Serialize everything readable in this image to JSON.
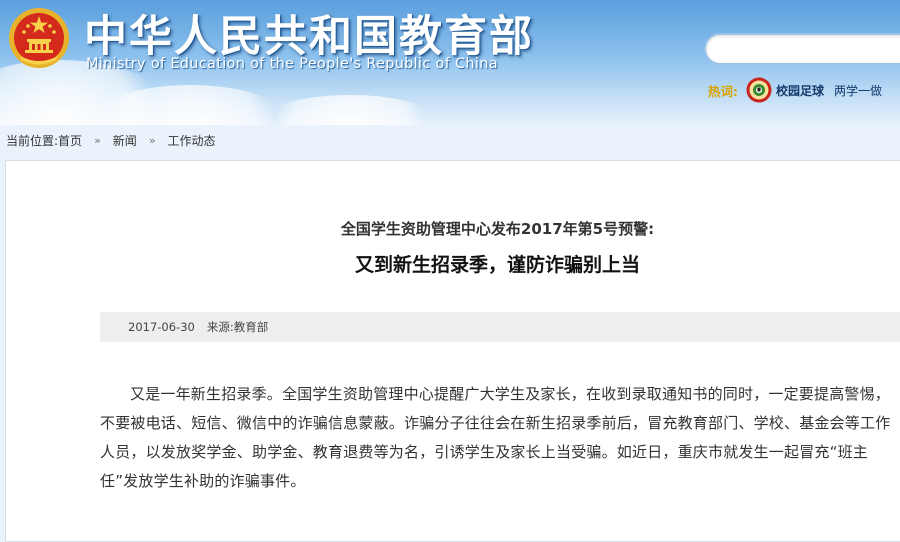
{
  "header": {
    "title": "中华人民共和国教育部",
    "subtitle": "Ministry of Education of the People's Republic of China",
    "search": {
      "value": "",
      "placeholder": ""
    },
    "hot": {
      "label": "热词:",
      "links": [
        "校园足球",
        "两学一做"
      ],
      "link_icons": [
        "football-icon"
      ]
    }
  },
  "breadcrumb": {
    "prefix": "当前位置:",
    "items": [
      "首页",
      "新闻",
      "工作动态"
    ],
    "separator": "»"
  },
  "article": {
    "subtitle": "全国学生资助管理中心发布2017年第5号预警:",
    "title": "又到新生招录季，谨防诈骗别上当",
    "date": "2017-06-30",
    "source": "来源:教育部",
    "body": "又是一年新生招录季。全国学生资助管理中心提醒广大学生及家长，在收到录取通知书的同时，一定要提高警惕，不要被电话、短信、微信中的诈骗信息蒙蔽。诈骗分子往往会在新生招录季前后，冒充教育部门、学校、基金会等工作人员，以发放奖学金、助学金、教育退费等为名，引诱学生及家长上当受骗。如近日，重庆市就发生一起冒充“班主任”发放学生补助的诈骗事件。"
  },
  "colors": {
    "header_blue": "#5a9fdd",
    "hot_label": "#d9a400",
    "link_navy": "#123a6b",
    "meta_bar": "#eeeeee"
  }
}
